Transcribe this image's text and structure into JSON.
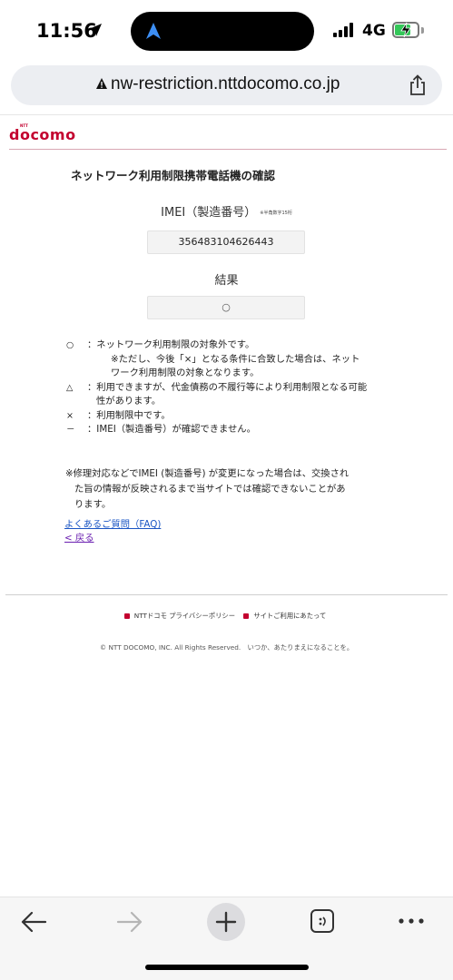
{
  "status": {
    "time": "11:56",
    "network": "4G"
  },
  "browser": {
    "url": "nw-restriction.nttdocomo.co.jp"
  },
  "brand": {
    "logo": "docomo",
    "logo_sub": "NTT"
  },
  "page": {
    "title": "ネットワーク利用制限携帯電話機の確認",
    "imei_label": "IMEI（製造番号）",
    "imei_hint": "※半角数字15桁",
    "imei_value": "356483104626443",
    "result_label": "結果",
    "result_value": "○"
  },
  "legend": [
    {
      "sym": "○",
      "text": "：ネットワーク利用制限の対象外です。"
    },
    {
      "sym": "",
      "text": "※ただし、今後「×」となる条件に合致した場合は、ネット"
    },
    {
      "sym": "",
      "text": "ワーク利用制限の対象となります。"
    },
    {
      "sym": "△",
      "text": "：利用できますが、代金債務の不履行等により利用制限となる可能"
    },
    {
      "sym": "",
      "text": "性があります。"
    },
    {
      "sym": "×",
      "text": "：利用制限中です。"
    },
    {
      "sym": "－",
      "text": "：IMEI（製造番号）が確認できません。"
    }
  ],
  "note": {
    "line1": "※修理対応などでIMEI (製造番号) が変更になった場合は、交換され",
    "line2": "た旨の情報が反映されるまで当サイトでは確認できないことがあ",
    "line3": "ります。"
  },
  "links": {
    "faq": "よくあるご質問（FAQ)",
    "back": "< 戻る"
  },
  "footer": {
    "privacy": "NTTドコモ プライバシーポリシー",
    "terms": "サイトご利用にあたって",
    "copyright": "© NTT DOCOMO, INC. All Rights Reserved.　いつか、あたりまえになることを。"
  }
}
